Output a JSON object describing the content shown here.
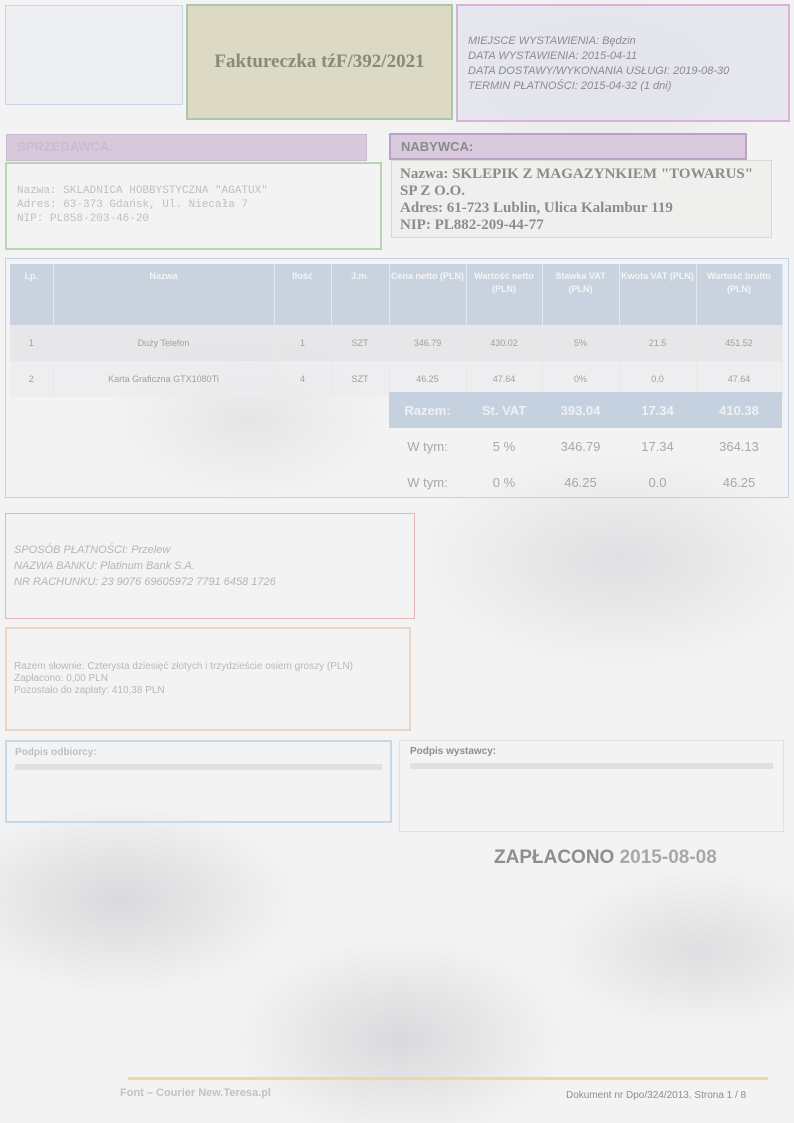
{
  "header": {
    "title": "Fakture​czka tźF/392/2021",
    "place_label": "MIEJSCE WYSTAWIENIA:",
    "place_value": "Będzin",
    "issue_label": "DATA WYSTAWIENIA:",
    "issue_value": "2015-04-11",
    "delivery_label": "DATA DOSTAWY/WYKONANIA USŁUGI:",
    "delivery_value": "2019-08-30",
    "due_label": "TERMIN PŁATNOŚCI:",
    "due_value": "2015-04-32 (1 dni)"
  },
  "seller": {
    "header": "SPRZEDAWCA:",
    "name": "Nazwa: SKLADNICA HOBBYSTYCZNA \"AGATUX\"",
    "address": "Adres: 63-373 Gdańsk, Ul. Niecała 7",
    "nip": "NIP: PL858-203-46-20"
  },
  "buyer": {
    "header": "NABYWCA:",
    "name": "Nazwa: SKLEPIK Z MAGAZYNKIEM \"TOWARUS\" SP Z O.O.",
    "address": "Adres: 61-723 Lublin, Ulica Kalambur 119",
    "nip": "NIP: PL882-209-44-77"
  },
  "table": {
    "headers": [
      "Lp.",
      "Nazwa",
      "Ilość",
      "J.m.",
      "Cena netto (PLN)",
      "Wartość netto (PLN)",
      "Stawka VAT (PLN)",
      "Kwota VAT (PLN)",
      "Wartość brutto (PLN)"
    ],
    "rows": [
      [
        "1",
        "Duży Telefon",
        "1",
        "SZT",
        "346.79",
        "430.02",
        "5%",
        "21.5",
        "451.52"
      ],
      [
        "2",
        "Karta Graficzna GTX1080Ti",
        "4",
        "SZT",
        "46.25",
        "47.64",
        "0%",
        "0.0",
        "47.64"
      ]
    ]
  },
  "summary": {
    "rows": [
      [
        "Razem:",
        "St. VAT",
        "393.04",
        "17.34",
        "410.38"
      ],
      [
        "W tym:",
        "5 %",
        "346.79",
        "17.34",
        "364.13"
      ],
      [
        "W tym:",
        "0 %",
        "46.25",
        "0.0",
        "46.25"
      ]
    ]
  },
  "payment": {
    "method": "SPOSÓB PŁATNOŚCI: Przelew",
    "bank": "NAZWA BANKU: Platinum Bank S.A.",
    "account": "NR RACHUNKU: 23 9076 69605972 7791 6458 1726"
  },
  "totals": {
    "words": "Razem słownie: Czterysta dziesięć złotych i trzydzieście osiem groszy (PLN)",
    "paid": "Zapłacono: 0,00 PLN",
    "remaining": "Pozostało do zapłaty: 410,38 PLN"
  },
  "signatures": {
    "receiver": "Podpis odbiorcy:",
    "issuer": "Podpis wystawcy:"
  },
  "stamp": {
    "label": "ZAPŁACONO",
    "date": "2015-08-08"
  },
  "footer": {
    "left": "Font – Courier New.Teresa.pl",
    "right": "Dokument nr Dpo/324/2013. Strona 1 / 8"
  }
}
